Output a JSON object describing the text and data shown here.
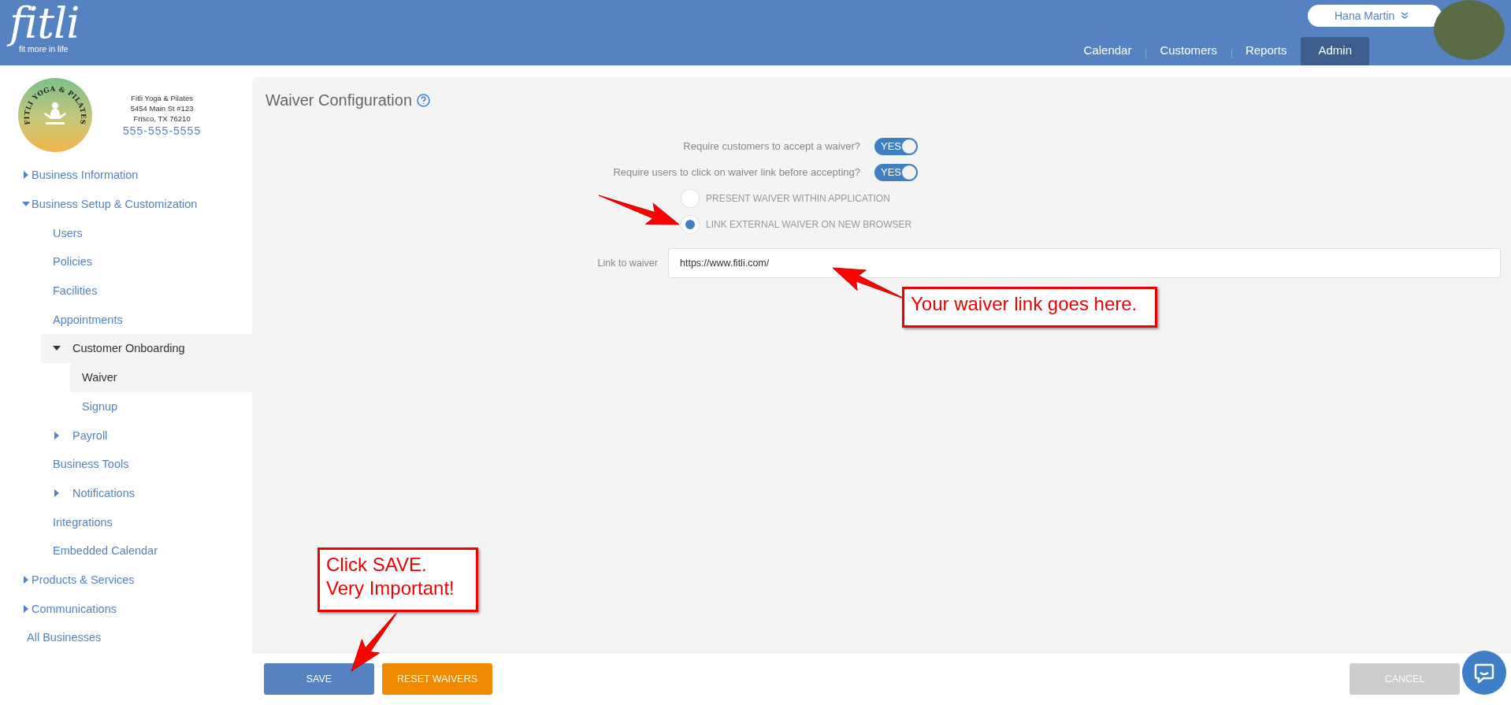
{
  "header": {
    "logo": {
      "wordmark": "fitli",
      "tagline": "fit more in life"
    },
    "user": {
      "name": "Hana Martin"
    },
    "nav": [
      {
        "label": "Calendar",
        "selected": false
      },
      {
        "label": "Customers",
        "selected": false
      },
      {
        "label": "Reports",
        "selected": false
      },
      {
        "label": "Admin",
        "selected": true
      }
    ]
  },
  "business": {
    "logo_text": "FITLI YOGA & PILATES",
    "name": "Fitli Yoga & Pilates",
    "address": "5454 Main St #123",
    "city": "Frisco, TX 76210",
    "phone": "555-555-5555"
  },
  "sidebar": {
    "items": [
      {
        "label": "Business Information",
        "expanded": false,
        "selected": false
      },
      {
        "label": "Business Setup & Customization",
        "expanded": true,
        "selected": false,
        "children": [
          {
            "label": "Users",
            "selected": false
          },
          {
            "label": "Policies",
            "selected": false
          },
          {
            "label": "Facilities",
            "selected": false
          },
          {
            "label": "Appointments",
            "selected": false
          },
          {
            "label": "Customer Onboarding",
            "expanded": true,
            "selected": true,
            "children": [
              {
                "label": "Waiver",
                "selected": true
              },
              {
                "label": "Signup",
                "selected": false
              }
            ]
          },
          {
            "label": "Payroll",
            "expanded": false,
            "selected": false
          },
          {
            "label": "Business Tools",
            "selected": false
          },
          {
            "label": "Notifications",
            "expanded": false,
            "selected": false
          },
          {
            "label": "Integrations",
            "selected": false
          },
          {
            "label": "Embedded Calendar",
            "selected": false
          }
        ]
      },
      {
        "label": "Products & Services",
        "expanded": false,
        "selected": false
      },
      {
        "label": "Communications",
        "expanded": false,
        "selected": false
      },
      {
        "label": "All Businesses",
        "selected": false
      }
    ]
  },
  "content": {
    "title": "Waiver Configuration",
    "toggles": [
      {
        "label": "Require customers to accept a waiver?",
        "on": true,
        "text": "YES"
      },
      {
        "label": "Require users to click on waiver link before accepting?",
        "on": true,
        "text": "YES"
      }
    ],
    "waiver_mode": [
      {
        "label": "PRESENT WAIVER WITHIN APPLICATION",
        "selected": false
      },
      {
        "label": "LINK EXTERNAL WAIVER ON NEW BROWSER",
        "selected": true
      }
    ],
    "link_field": {
      "label": "Link to waiver",
      "value": "https://www.fitli.com/"
    }
  },
  "footer": {
    "buttons": [
      {
        "label": "SAVE",
        "kind": "primary"
      },
      {
        "label": "RESET WAIVERS",
        "kind": "warning"
      },
      {
        "label": "CANCEL",
        "kind": "disabled"
      }
    ]
  },
  "annotations": [
    {
      "kind": "link",
      "text": "Your waiver link goes here."
    },
    {
      "kind": "save",
      "text": "Click SAVE.\nVery Important!"
    }
  ]
}
